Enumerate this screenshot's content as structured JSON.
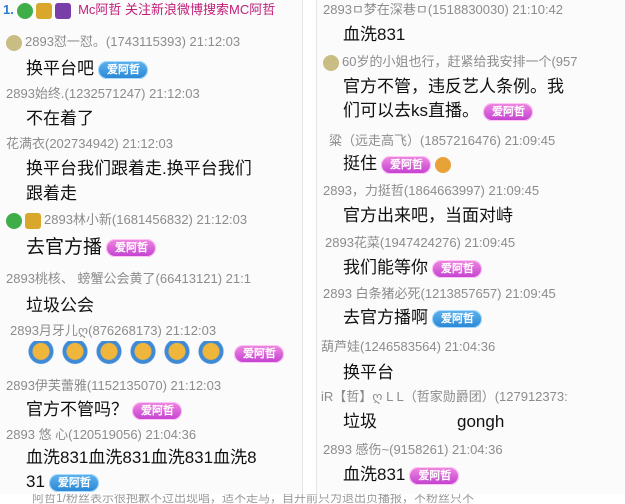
{
  "left": {
    "header": {
      "prefix": "1.",
      "title": "Mc阿哲 关注新浪微博搜索MC阿哲"
    },
    "rows": [
      {
        "meta": "2893怼一怼。(1743115393) 21:12:03"
      },
      {
        "msg": "换平台吧",
        "badge": "爱阿哲"
      },
      {
        "meta": "2893始终.(1232571247) 21:12:03"
      },
      {
        "msg": "不在着了"
      },
      {
        "meta": "花满衣(202734942) 21:12:03"
      },
      {
        "msg": "换平台我们跟着走.换平台我们"
      },
      {
        "msg": "跟着走"
      },
      {
        "meta": "2893林小新(1681456832) 21:12:03"
      },
      {
        "msg": "去官方播",
        "badge": "爱阿哲"
      },
      {
        "meta": "2893桃核、  螃蟹公会黄了(66413121) 21:1"
      },
      {
        "msg": "垃圾公会"
      },
      {
        "meta": "2893月牙儿ღ(876268173) 21:12:03"
      },
      {
        "badge": "爱阿哲"
      },
      {
        "meta": "2893伊芙蕾雅(1152135070) 21:12:03"
      },
      {
        "msg": "官方不管吗？",
        "badge": "爱阿哲"
      },
      {
        "meta": "2893 悠  心(120519056) 21:04:36"
      },
      {
        "msg": "血洗831血洗831血洗831血洗8"
      },
      {
        "msg": "31",
        "badge": "爱阿哲"
      }
    ]
  },
  "right": {
    "rows": [
      {
        "meta": "2893ㅁ梦在深巷ㅁ(1518830030) 21:10:42"
      },
      {
        "msg": "血洗831"
      },
      {
        "meta": "60岁的小姐也行，赶紧给我安排一个(957"
      },
      {
        "msg": "官方不管，违反艺人条例。我"
      },
      {
        "msg": "们可以去ks直播。",
        "badge": "爱阿哲"
      },
      {
        "meta": "粱（远走高飞）(1857216476) 21:09:45"
      },
      {
        "msg": "挺住",
        "badge": "爱阿哲"
      },
      {
        "meta": "2893，力挺哲(1864663997) 21:09:45"
      },
      {
        "msg": "官方出来吧，当面对峙"
      },
      {
        "meta": "2893花菜(1947424276) 21:09:45"
      },
      {
        "msg": "我们能等你",
        "badge": "爱阿哲"
      },
      {
        "meta": "2893  白条猪必死(1213857657) 21:09:45"
      },
      {
        "msg": "去官方播啊",
        "badge": "爱阿哲"
      },
      {
        "meta": "葫芦娃(1246583564) 21:04:36"
      },
      {
        "msg": "换平台"
      },
      {
        "meta": "iR【哲】ღ L L（哲家勋爵团）(127912373:"
      },
      {
        "msg": "垃圾",
        "msg2": "gongh"
      },
      {
        "meta": "2893 感伤~(9158261) 21:04:36"
      },
      {
        "msg": "血洗831",
        "badge": "爱阿哲"
      }
    ]
  },
  "footer": {
    "text": "阿哲1/粉丝表示很抱歉不过出现唱，适不走马，自开前只为退出页播报，不粉丝只不"
  },
  "colors": {
    "badge_blue": "#2a86d4",
    "badge_pink": "#c23fd0",
    "meta": "#8c8c8c"
  }
}
